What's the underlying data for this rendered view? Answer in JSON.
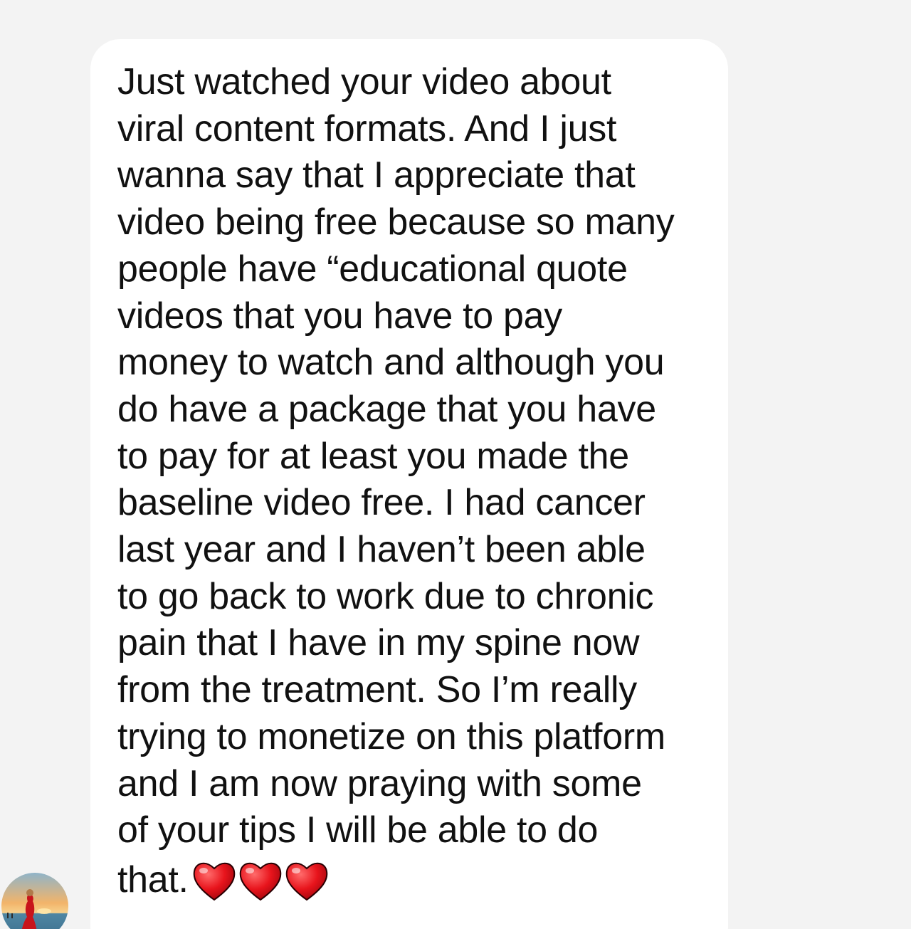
{
  "conversation": {
    "message": {
      "lines": [
        "Just watched your video about",
        "viral content formats. And I just",
        "wanna say that I appreciate that",
        "video being free because so many",
        "people have “educational quote",
        "videos that you have to pay",
        "money to watch and although you",
        "do have a package that you have",
        "to pay for at least you made the",
        "baseline video free. I had cancer",
        "last year and I haven’t been able",
        "to go back to work due to chronic",
        "pain that I have in my spine now",
        "from the treatment. So I’m really",
        "trying to monetize on this platform",
        "and I am now praying with some",
        "of your tips I will be able to do"
      ],
      "last_line": "that.",
      "emoji": [
        "red-heart-emoji",
        "red-heart-emoji",
        "red-heart-emoji"
      ]
    },
    "sender_avatar": "sender-avatar"
  },
  "colors": {
    "background": "#f3f3f3",
    "bubble": "#ffffff",
    "text": "#111111",
    "heart": "#e8141c"
  }
}
